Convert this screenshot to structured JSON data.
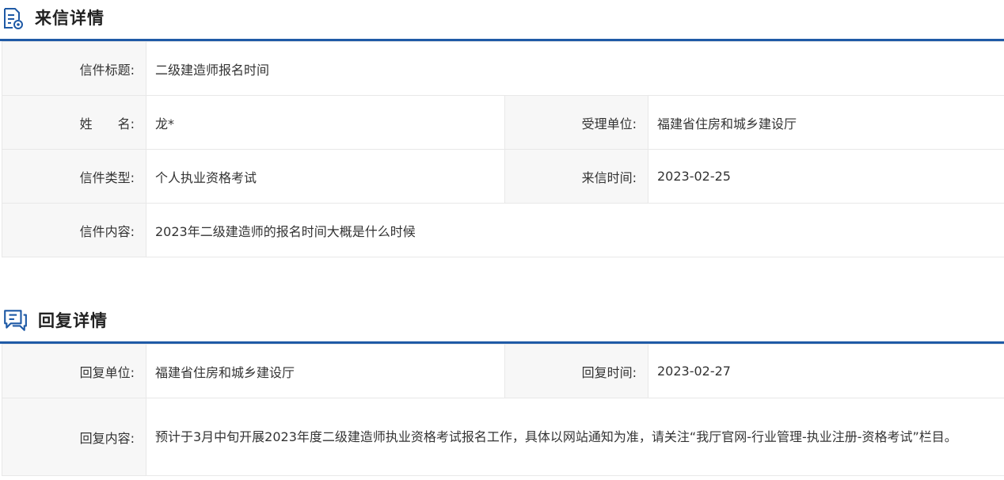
{
  "letter_section": {
    "title": "来信详情",
    "icon": "document-eye-icon",
    "subject_label": "信件标题:",
    "subject_value": "二级建造师报名时间",
    "name_label": "姓　　名:",
    "name_value": "龙*",
    "recv_unit_label": "受理单位:",
    "recv_unit_value": "福建省住房和城乡建设厅",
    "type_label": "信件类型:",
    "type_value": "个人执业资格考试",
    "date_label": "来信时间:",
    "date_value": "2023-02-25",
    "content_label": "信件内容:",
    "content_value": "2023年二级建造师的报名时间大概是什么时候"
  },
  "reply_section": {
    "title": "回复详情",
    "icon": "chat-bubbles-icon",
    "unit_label": "回复单位:",
    "unit_value": "福建省住房和城乡建设厅",
    "date_label": "回复时间:",
    "date_value": "2023-02-27",
    "content_label": "回复内容:",
    "content_value": "预计于3月中旬开展2023年度二级建造师执业资格考试报名工作，具体以网站通知为准，请关注“我厅官网-行业管理-执业注册-资格考试”栏目。"
  },
  "colors": {
    "accent": "#1f5aa6",
    "label_bg": "#f7f7f7",
    "border": "#e8e8e8"
  }
}
